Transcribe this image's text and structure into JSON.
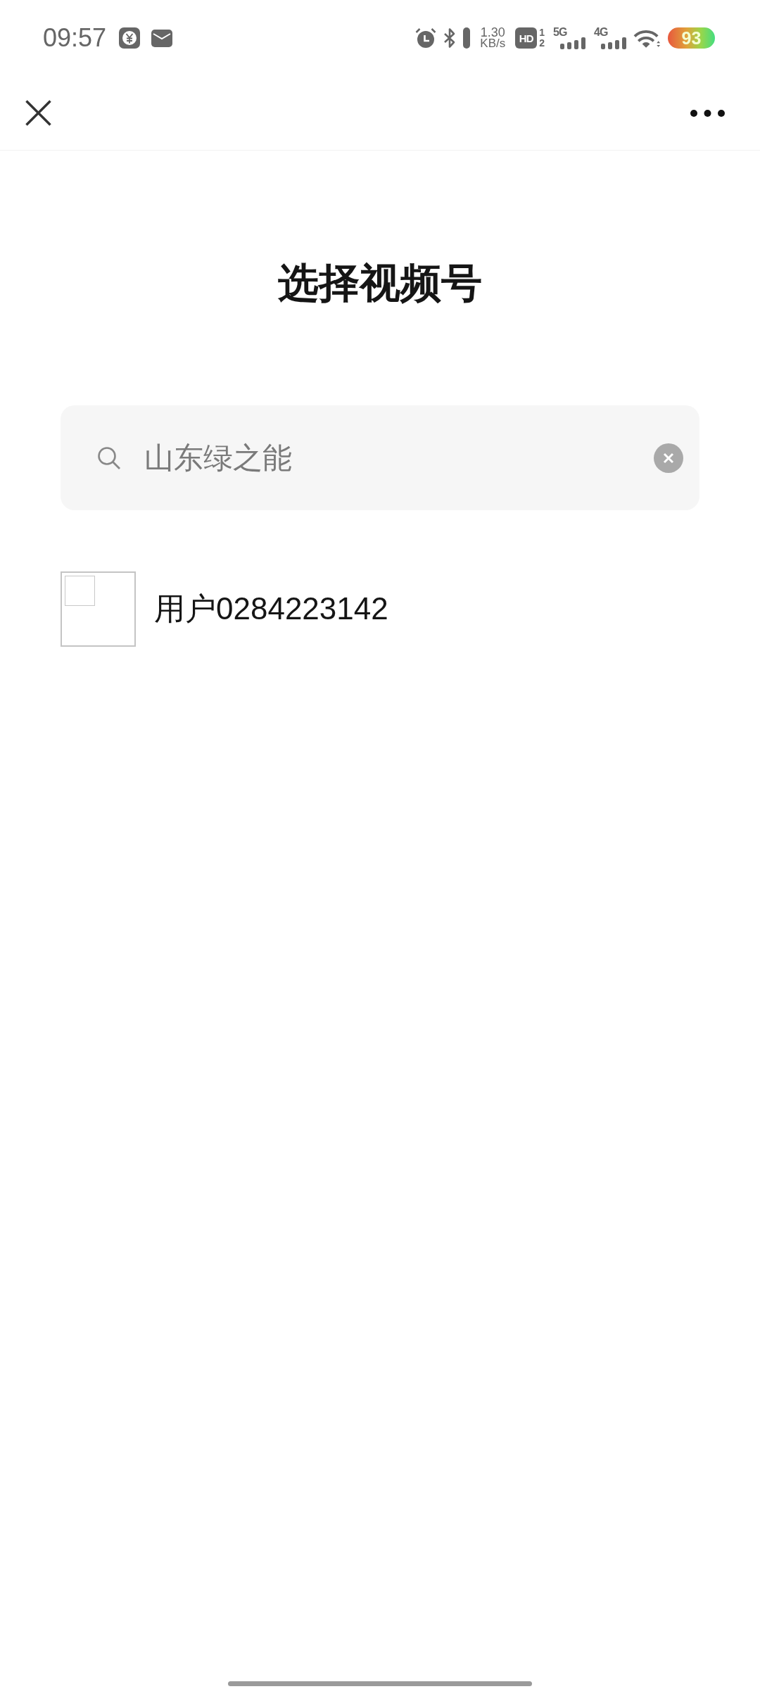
{
  "status_bar": {
    "time": "09:57",
    "network_speed": {
      "value": "1.30",
      "unit": "KB/s"
    },
    "hd": {
      "label": "HD",
      "sims": [
        "1",
        "2"
      ]
    },
    "networks": [
      {
        "label": "5G"
      },
      {
        "label": "4G"
      }
    ],
    "battery": "93"
  },
  "title": "选择视频号",
  "search": {
    "value": "山东绿之能"
  },
  "results": [
    {
      "name": "用户0284223142"
    }
  ]
}
